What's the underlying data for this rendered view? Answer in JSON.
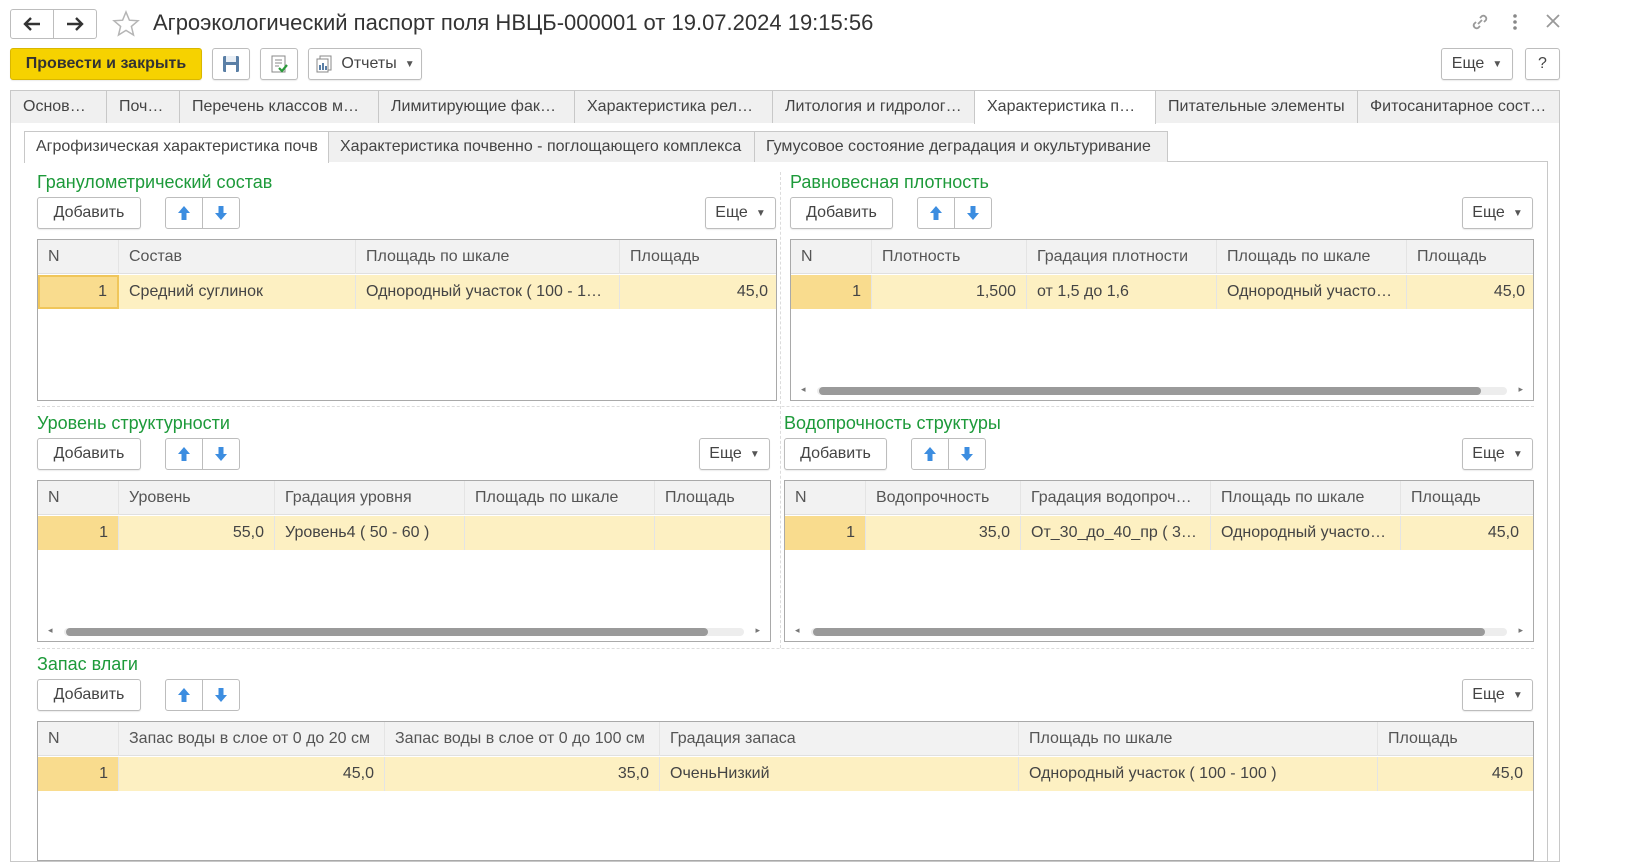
{
  "window": {
    "title": "Агроэкологический паспорт поля НВЦБ-000001 от 19.07.2024 19:15:56"
  },
  "toolbar": {
    "post_close_label": "Провести и закрыть",
    "reports_label": "Отчеты",
    "more_label": "Еще",
    "help_label": "?"
  },
  "tabs": [
    "Основное",
    "Почвы",
    "Перечень классов ме…",
    "Лимитирующие факт…",
    "Характеристика рель…",
    "Литология и гидрология",
    "Характеристика почв",
    "Питательные элементы",
    "Фитосанитарное сост…"
  ],
  "subtabs": [
    "Агрофизическая характеристика почв",
    "Характеристика почвенно - поглощающего комплекса",
    "Гумусовое состояние деградация и окультуривание"
  ],
  "common": {
    "add_label": "Добавить",
    "more_label": "Еще"
  },
  "granulometric": {
    "title": "Гранулометрический состав",
    "columns": [
      "N",
      "Состав",
      "Площадь по шкале",
      "Площадь"
    ],
    "rows": [
      [
        "1",
        "Средний суглинок",
        "Однородный участок ( 100 - 1…",
        "45,0"
      ]
    ]
  },
  "density": {
    "title": "Равновесная плотность",
    "columns": [
      "N",
      "Плотность",
      "Градация плотности",
      "Площадь по шкале",
      "Площадь"
    ],
    "rows": [
      [
        "1",
        "1,500",
        "от 1,5 до 1,6",
        "Однородный участо…",
        "45,0"
      ]
    ]
  },
  "structure": {
    "title": "Уровень структурности",
    "columns": [
      "N",
      "Уровень",
      "Градация уровня",
      "Площадь по шкале",
      "Площадь"
    ],
    "rows": [
      [
        "1",
        "55,0",
        "Уровень4 ( 50 - 60 )",
        "",
        ""
      ]
    ]
  },
  "water_stability": {
    "title": "Водопрочность структуры",
    "columns": [
      "N",
      "Водопрочность",
      "Градация водопрочн…",
      "Площадь по шкале",
      "Площадь"
    ],
    "rows": [
      [
        "1",
        "35,0",
        "От_30_до_40_пр ( 3…",
        "Однородный участо…",
        "45,0"
      ]
    ]
  },
  "moisture": {
    "title": "Запас влаги",
    "columns": [
      "N",
      "Запас воды в слое от 0 до 20 см",
      "Запас воды в слое от 0 до 100 см",
      "Градация запаса",
      "Площадь по шкале",
      "Площадь"
    ],
    "rows": [
      [
        "1",
        "45,0",
        "35,0",
        "ОченьНизкий",
        "Однородный участок ( 100 - 100 )",
        "45,0"
      ]
    ]
  }
}
